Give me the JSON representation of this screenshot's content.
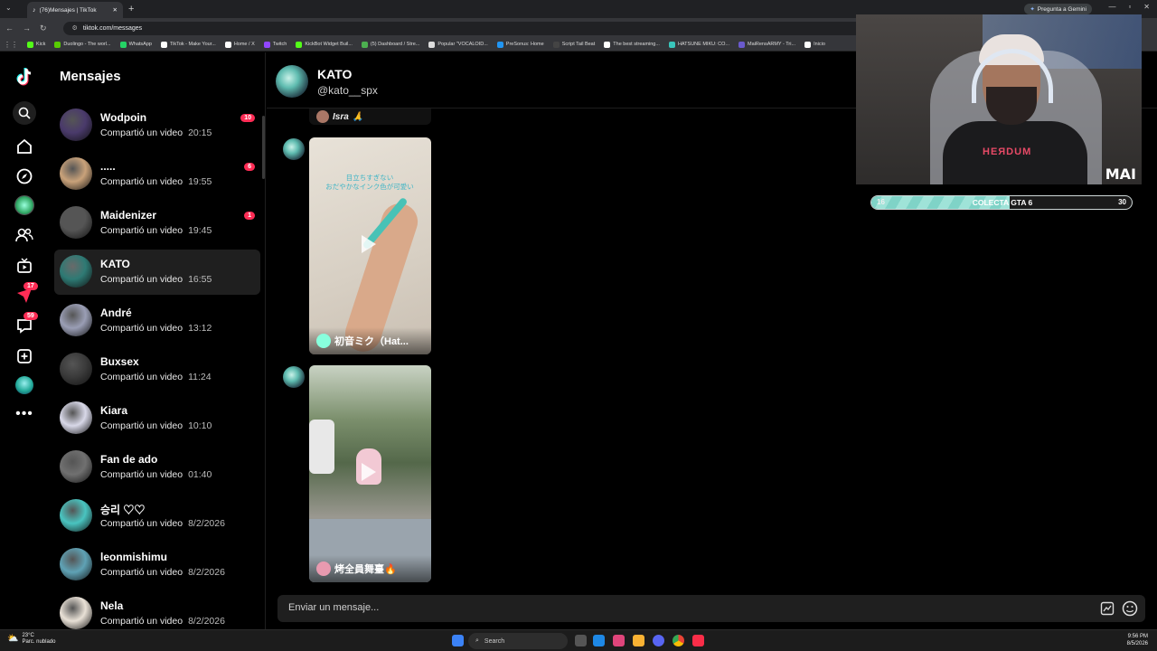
{
  "browser": {
    "tab_title": "(76)Mensajes | TikTok",
    "url": "tiktok.com/messages",
    "gemini_label": "Pregunta a Gemini",
    "bookmarks": [
      {
        "label": "Kick",
        "color": "#53fc18"
      },
      {
        "label": "Duolingo - The worl...",
        "color": "#58cc02"
      },
      {
        "label": "WhatsApp",
        "color": "#25d366"
      },
      {
        "label": "TikTok - Make Your...",
        "color": "#ffffff"
      },
      {
        "label": "Home / X",
        "color": "#ffffff"
      },
      {
        "label": "Twitch",
        "color": "#9146ff"
      },
      {
        "label": "KickBot Widget Buil...",
        "color": "#53fc18"
      },
      {
        "label": "(5) Dashboard / Stre...",
        "color": "#4caf50"
      },
      {
        "label": "Popular \"VOCALOID...",
        "color": "#dddddd"
      },
      {
        "label": "PreSonus: Home",
        "color": "#2196f3"
      },
      {
        "label": "Script Tail Beat",
        "color": "#444444"
      },
      {
        "label": "The best streaming...",
        "color": "#ffffff"
      },
      {
        "label": "HATSUNE MIKU: CO...",
        "color": "#39c5bb"
      },
      {
        "label": "MaiRensARMY - Tri...",
        "color": "#6a5acd"
      },
      {
        "label": "Inicio",
        "color": "#ffffff"
      }
    ]
  },
  "sidebar": {
    "title": "Mensajes",
    "badges": {
      "inbox": "17",
      "activity": "59"
    },
    "conversations": [
      {
        "name": "Wodpoin",
        "preview": "Compartió un video",
        "time": "20:15",
        "unread": "10",
        "avatar": "#4a3a6b"
      },
      {
        "name": ".....",
        "preview": "Compartió un video",
        "time": "19:55",
        "unread": "6",
        "avatar": "#c9a27a"
      },
      {
        "name": "Maidenizer",
        "preview": "Compartió un video",
        "time": "19:45",
        "unread": "1",
        "avatar": "#555555"
      },
      {
        "name": "KATO",
        "preview": "Compartió un video",
        "time": "16:55",
        "unread": "",
        "avatar": "#2e7a74"
      },
      {
        "name": "André",
        "preview": "Compartió un video",
        "time": "13:12",
        "unread": "",
        "avatar": "#9a9eb5"
      },
      {
        "name": "Buxsex",
        "preview": "Compartió un video",
        "time": "11:24",
        "unread": "",
        "avatar": "#3b3b3b"
      },
      {
        "name": "Kiara",
        "preview": "Compartió un video",
        "time": "10:10",
        "unread": "",
        "avatar": "#d8d8e8"
      },
      {
        "name": "Fan de ado",
        "preview": "Compartió un video",
        "time": "01:40",
        "unread": "",
        "avatar": "#707070"
      },
      {
        "name": "승리 ♡♡",
        "preview": "Compartió un video",
        "time": "8/2/2026",
        "unread": "",
        "avatar": "#49c4c0"
      },
      {
        "name": "leonmishimu",
        "preview": "Compartió un video",
        "time": "8/2/2026",
        "unread": "",
        "avatar": "#5fa2b5"
      },
      {
        "name": "Nela",
        "preview": "Compartió un video",
        "time": "8/2/2026",
        "unread": "",
        "avatar": "#e9e1d6"
      }
    ]
  },
  "chat": {
    "name": "KATO",
    "handle": "@kato__spx",
    "partial_caption": "Isra",
    "videos": [
      {
        "caption": "初音ミク（Hat...",
        "overlay_text": "目立ちすぎない\nおだやかなインク色が可愛い"
      },
      {
        "caption": "烤全員舞臺🔥",
        "overlay_text": ""
      }
    ],
    "composer_placeholder": "Enviar un mensaje..."
  },
  "overlay": {
    "brand": "MAI",
    "shirt_text": "HEЯDUM",
    "goal": {
      "label": "COLECTA GTA 6",
      "current": "16",
      "target": "30",
      "progress": 0.53
    }
  },
  "taskbar": {
    "temperature": "23°C",
    "weather": "Parc. nublado",
    "search": "Search",
    "time": "9:56 PM",
    "date": "8/5/2026"
  }
}
